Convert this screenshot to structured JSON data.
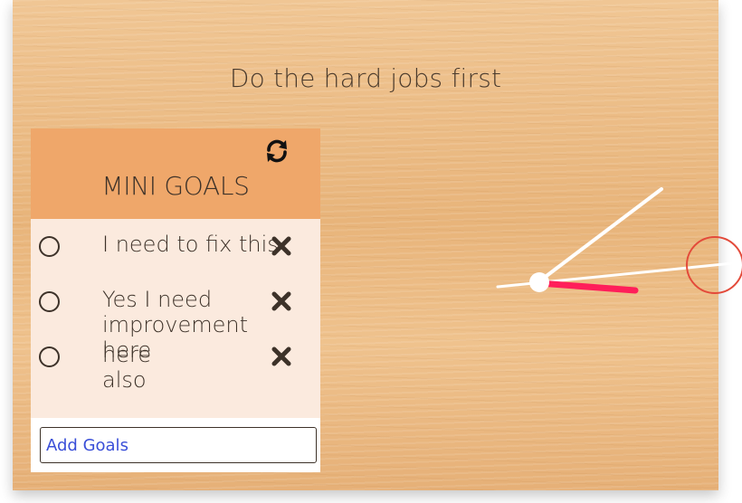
{
  "quote": {
    "text": "Do the hard jobs first"
  },
  "goals": {
    "title": "MINI GOALS",
    "icons": {
      "refresh": "refresh-icon",
      "delete": "close-x-icon",
      "status": "radio-circle-icon"
    },
    "items": [
      {
        "text": "I need to fix this",
        "completed": false
      },
      {
        "text": "Yes I need improvement here",
        "completed": false
      },
      {
        "text": "here also",
        "completed": false
      }
    ],
    "add_input": {
      "placeholder": "Add Goals",
      "value": ""
    }
  },
  "clock": {
    "hand_color": "#ffffff",
    "second_hand_color": "#ff1f5a",
    "center_color": "#ffffff",
    "marker_color": "#e34a3a"
  },
  "colors": {
    "header_bg": "#efa76a",
    "panel_bg": "#fbeade",
    "text": "#3d3229",
    "input_text": "#3a4fd8"
  }
}
